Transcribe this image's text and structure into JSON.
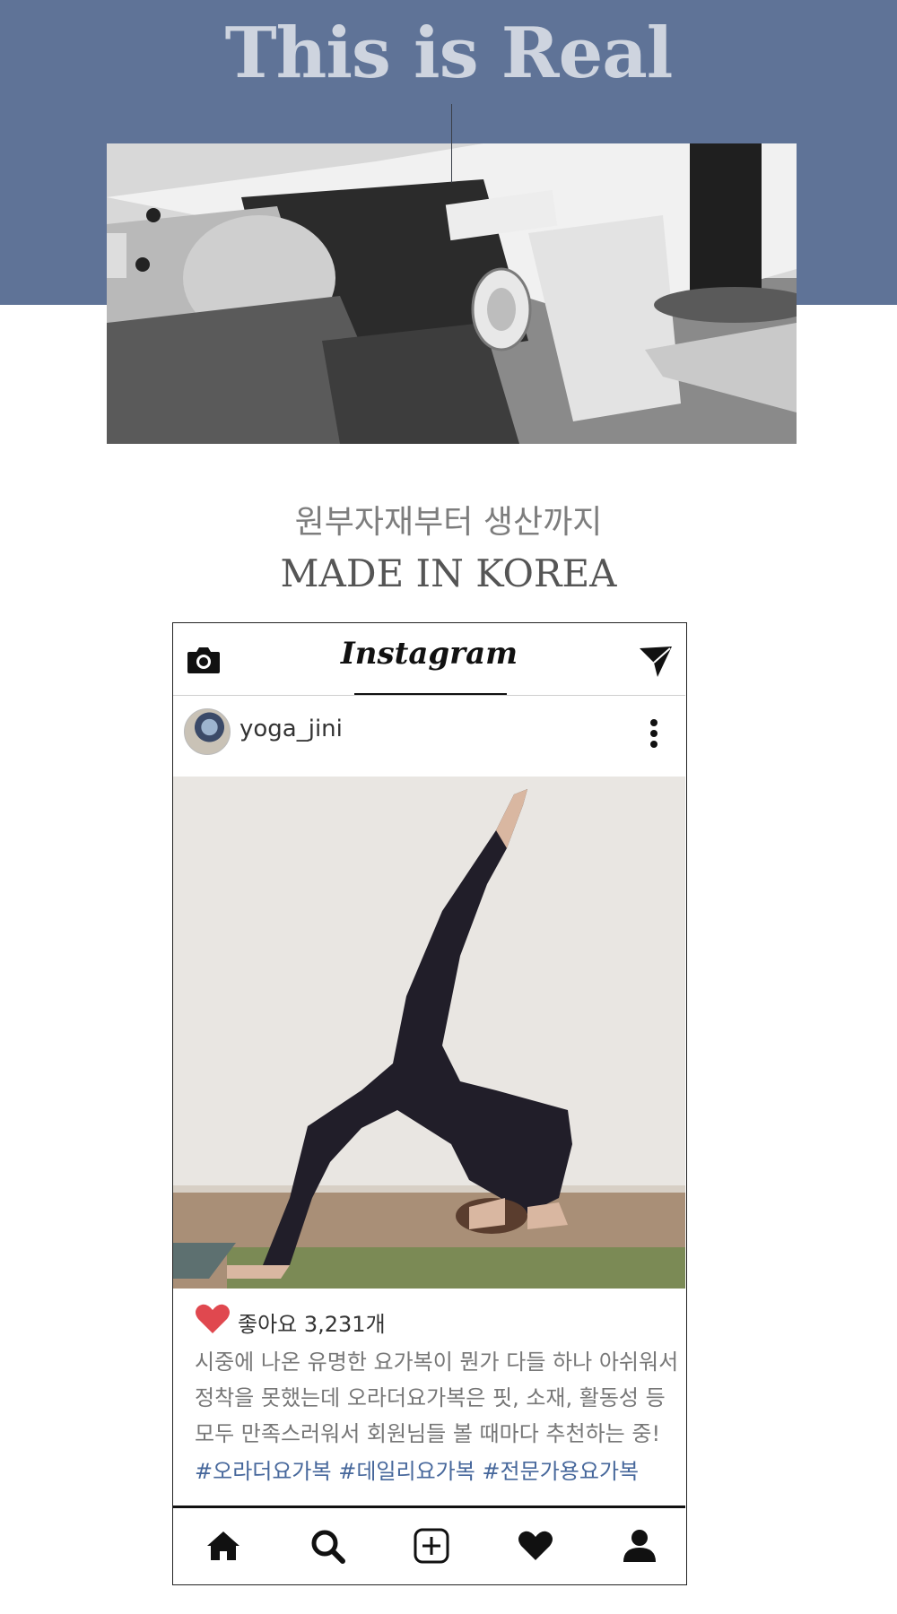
{
  "hero": {
    "title": "This is Real",
    "background": "#5f7397"
  },
  "section": {
    "subtitle_ko": "원부자재부터 생산까지",
    "subtitle_en": "MADE IN KOREA"
  },
  "instagram": {
    "logo": "Instagram",
    "username": "yoga_jini",
    "likes": "좋아요 3,231개",
    "caption": "시중에 나온 유명한 요가복이 뭔가 다들 하나 아쉬워서 정착을 못했는데 오라더요가복은 핏, 소재, 활동성 등 모두 만족스러워서 회원님들 볼 때마다 추천하는 중!",
    "hashtags": "#오라더요가복 #데일리요가복 #전문가용요가복",
    "icons": [
      "camera-icon",
      "send-icon",
      "more-icon",
      "heart-icon",
      "home-icon",
      "search-icon",
      "add-icon",
      "heart-icon",
      "profile-icon"
    ],
    "accent": "#e0484f",
    "hashtag_color": "#46679b"
  }
}
